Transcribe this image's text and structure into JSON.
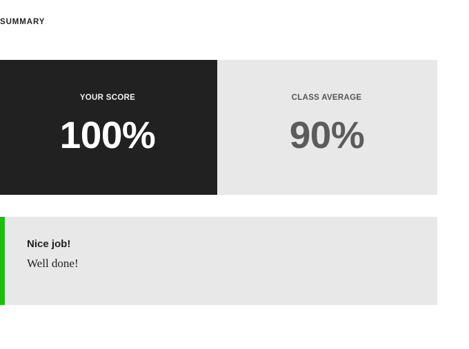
{
  "summary": {
    "heading": "SUMMARY"
  },
  "scores": {
    "yours": {
      "label": "YOUR SCORE",
      "value": "100%"
    },
    "average": {
      "label": "CLASS AVERAGE",
      "value": "90%"
    }
  },
  "feedback": {
    "title": "Nice job!",
    "message": "Well done!",
    "accent_color": "#19c10b"
  },
  "colors": {
    "dark_panel": "#212121",
    "light_panel": "#e8e8e8"
  }
}
